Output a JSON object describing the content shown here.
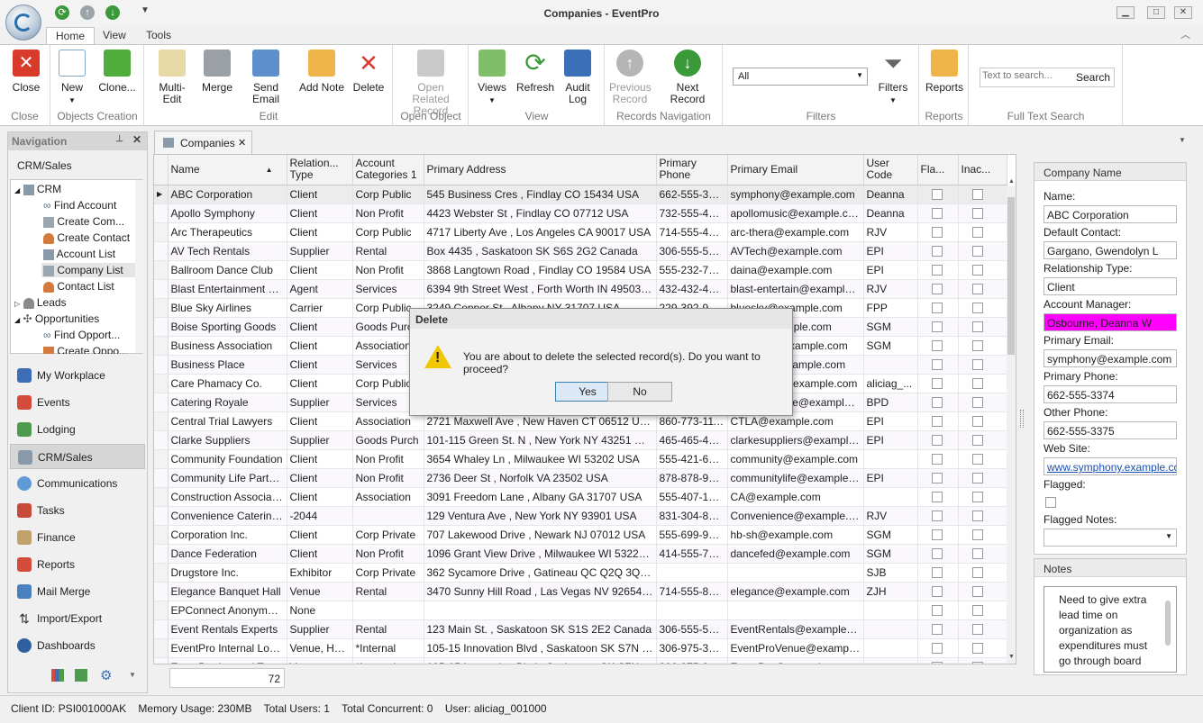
{
  "window": {
    "title": "Companies - EventPro",
    "minimize": "▁",
    "maximize": "□",
    "close": "✕"
  },
  "ribbon_tabs": [
    "Home",
    "View",
    "Tools"
  ],
  "ribbon": {
    "close": "Close",
    "new": "New",
    "clone": "Clone...",
    "multi_edit": "Multi-Edit",
    "merge": "Merge",
    "send_email": "Send Email",
    "add_note": "Add Note",
    "delete": "Delete",
    "open_related_1": "Open Related",
    "open_related_2": "Record",
    "views": "Views",
    "refresh": "Refresh",
    "audit_1": "Audit",
    "audit_2": "Log",
    "previous_1": "Previous",
    "previous_2": "Record",
    "next_record": "Next Record",
    "filter_value": "All",
    "filters": "Filters",
    "reports": "Reports",
    "search_placeholder": "Text to search...",
    "search": "Search",
    "groups": [
      "Close",
      "Objects Creation",
      "Edit",
      "Open Object",
      "View",
      "Records Navigation",
      "Filters",
      "Reports",
      "Full Text Search"
    ]
  },
  "navigation": {
    "title": "Navigation",
    "section": "CRM/Sales",
    "tree": [
      "CRM",
      "Find Account",
      "Create Com...",
      "Create Contact",
      "Account List",
      "Company List",
      "Contact List",
      "Leads",
      "Opportunities",
      "Find Opport...",
      "Create Oppo..."
    ],
    "modules": [
      "My Workplace",
      "Events",
      "Lodging",
      "CRM/Sales",
      "Communications",
      "Tasks",
      "Finance",
      "Reports",
      "Mail Merge",
      "Import/Export",
      "Dashboards"
    ]
  },
  "doc_tab": "Companies",
  "grid": {
    "columns": [
      "Name",
      "Relation... Type",
      "Account Categories 1",
      "Primary Address",
      "Primary Phone",
      "Primary Email",
      "User Code",
      "Fla...",
      "Inac..."
    ],
    "rows": [
      [
        "ABC Corporation",
        "Client",
        "Corp Public",
        "545 Business Cres , Findlay CO 15434 USA",
        "662-555-3374",
        "symphony@example.com",
        "Deanna"
      ],
      [
        "Apollo Symphony",
        "Client",
        "Non Profit",
        "4423 Webster St , Findlay CO 07712 USA",
        "732-555-4906",
        "apollomusic@example.com",
        "Deanna"
      ],
      [
        "Arc Therapeutics",
        "Client",
        "Corp Public",
        "4717 Liberty Ave , Los Angeles CA 90017 USA",
        "714-555-4504",
        "arc-thera@example.com",
        "RJV"
      ],
      [
        "AV Tech Rentals",
        "Supplier",
        "Rental",
        "Box 4435 , Saskatoon SK S6S 2G2 Canada",
        "306-555-5552",
        "AVTech@example.com",
        "EPI"
      ],
      [
        "Ballroom Dance Club",
        "Client",
        "Non Profit",
        "3868 Langtown Road , Findlay CO 19584 USA",
        "555-232-7335",
        "daina@example.com",
        "EPI"
      ],
      [
        "Blast Entertainment Co.",
        "Agent",
        "Services",
        "6394 9th Street West , Forth Worth IN 49503 USA",
        "432-432-4322",
        "blast-entertain@example.com",
        "RJV"
      ],
      [
        "Blue Sky Airlines",
        "Carrier",
        "Corp Public",
        "3249 Copper St , Albany NY 31707 USA",
        "229-392-9795",
        "bluesky@example.com",
        "FPP"
      ],
      [
        "Boise Sporting Goods",
        "Client",
        "Goods Purch",
        "",
        "",
        "boise@example.com",
        "SGM"
      ],
      [
        "Business Association",
        "Client",
        "Association",
        "",
        "",
        "bizassoc@example.com",
        "SGM"
      ],
      [
        "Business Place",
        "Client",
        "Services",
        "",
        "",
        "bizplace@example.com",
        ""
      ],
      [
        "Care Phamacy Co.",
        "Client",
        "Corp Public",
        "",
        "",
        "carepharm@example.com",
        "aliciag_..."
      ],
      [
        "Catering Royale",
        "Supplier",
        "Services",
        "",
        "",
        "cateringroyale@example.c...",
        "BPD"
      ],
      [
        "Central Trial Lawyers",
        "Client",
        "Association",
        "2721 Maxwell Ave , New Haven CT 06512 USA",
        "860-773-1111",
        "CTLA@example.com",
        "EPI"
      ],
      [
        "Clarke Suppliers",
        "Supplier",
        "Goods Purch",
        "101-115  Green St. N , New York NY 43251 USA",
        "465-465-4656",
        "clarkesuppliers@example.com",
        "EPI"
      ],
      [
        "Community Foundation",
        "Client",
        "Non Profit",
        "3654 Whaley Ln , Milwaukee WI 53202 USA",
        "555-421-6439",
        "community@example.com",
        ""
      ],
      [
        "Community Life Partner...",
        "Client",
        "Non Profit",
        "2736 Deer St , Norfolk VA 23502 USA",
        "878-878-9865",
        "communitylife@example.com",
        "EPI"
      ],
      [
        "Construction Association",
        "Client",
        "Association",
        "3091 Freedom Lane , Albany GA 31707 USA",
        "555-407-1371",
        "CA@example.com",
        ""
      ],
      [
        "Convenience Catering ...",
        "-2044",
        "",
        "129 Ventura Ave , New York NY 93901 USA",
        "831-304-8772",
        "Convenience@example.com",
        "RJV"
      ],
      [
        "Corporation Inc.",
        "Client",
        "Corp Private",
        "707 Lakewood Drive , Newark NJ 07012 USA",
        "555-699-9413",
        "hb-sh@example.com",
        "SGM"
      ],
      [
        "Dance Federation",
        "Client",
        "Non Profit",
        "1096 Grant View Drive , Milwaukee WI 53223 USA",
        "414-555-7711",
        "dancefed@example.com",
        "SGM"
      ],
      [
        "Drugstore Inc.",
        "Exhibitor",
        "Corp Private",
        "362 Sycamore Drive , Gatineau QC Q2Q 3Q3 Can...",
        "",
        "",
        "SJB"
      ],
      [
        "Elegance Banquet Hall",
        "Venue",
        "Rental",
        "3470 Sunny Hill Road , Las Vegas NV 92654 USA",
        "714-555-8181",
        "elegance@example.com",
        "ZJH"
      ],
      [
        "EPConnect Anonymous",
        "None",
        "",
        "",
        "",
        "",
        ""
      ],
      [
        "Event Rentals Experts",
        "Supplier",
        "Rental",
        "123 Main St. , Saskatoon SK S1S 2E2 Canada",
        "306-555-5555",
        "EventRentals@example.com",
        ""
      ],
      [
        "EventPro Internal Lodg...",
        "Venue, Hotel",
        "*Internal",
        "105-15 Innovation Blvd , Saskatoon SK S7N 2X8 ...",
        "306-975-3737",
        "EventProVenue@example....",
        ""
      ],
      [
        "EventPro Internal Tr...",
        "Venue",
        "*Internal",
        "105-15 Innovation Blvd , Saskatoon SK S7N 2X8",
        "306-975-3737",
        "EventPro@example.com",
        ""
      ]
    ],
    "record_count": "72"
  },
  "detail": {
    "header": "Company Name",
    "name_label": "Name:",
    "name": "ABC Corporation",
    "contact_label": "Default Contact:",
    "contact": "Gargano, Gwendolyn L",
    "reltype_label": "Relationship Type:",
    "reltype": "Client",
    "manager_label": "Account Manager:",
    "manager": "Osbourne, Deanna W",
    "email_label": "Primary Email:",
    "email": "symphony@example.com",
    "phone_label": "Primary Phone:",
    "phone": "662-555-3374",
    "other_phone_label": "Other Phone:",
    "other_phone": "662-555-3375",
    "website_label": "Web Site:",
    "website": "www.symphony.example.com",
    "flagged_label": "Flagged:",
    "flagged_notes_label": "Flagged Notes:",
    "manager_highlight": "#ff00ff"
  },
  "notes": {
    "header": "Notes",
    "text": "Need to give extra lead time on organization as expenditures must go through board approval"
  },
  "status": {
    "client_id": "Client ID: PSI001000AK",
    "memory": "Memory Usage: 230MB",
    "total_users": "Total Users: 1",
    "concurrent": "Total Concurrent: 0",
    "user": "User: aliciag_001000"
  },
  "dialog": {
    "title": "Delete",
    "message": "You are about to delete the selected record(s). Do you want to proceed?",
    "yes": "Yes",
    "no": "No",
    "icon": "warning-icon"
  }
}
